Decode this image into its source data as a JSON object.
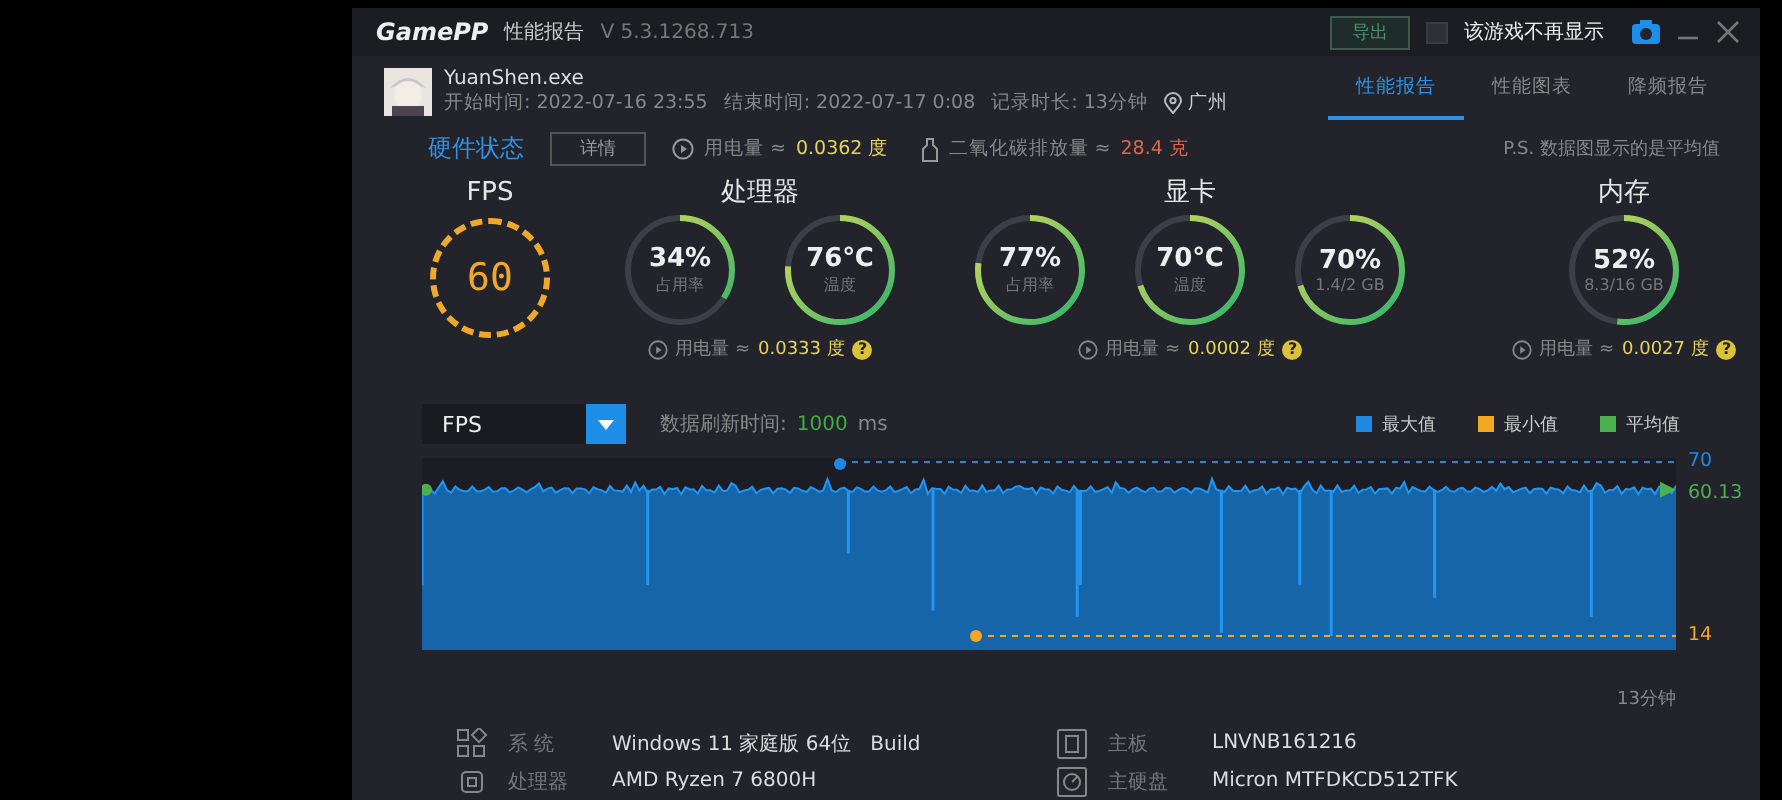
{
  "window": {
    "logo": "GamePP",
    "title": "性能报告",
    "version": "V 5.3.1268.713",
    "export_button": "导出",
    "hide_checkbox": {
      "label": "该游戏不再显示",
      "checked": false
    }
  },
  "session": {
    "exe": "YuanShen.exe",
    "start": "开始时间: 2022-07-16 23:55",
    "end": "结束时间: 2022-07-17 0:08",
    "duration": "记录时长: 13分钟",
    "location": "广州"
  },
  "tabs": [
    {
      "label": "性能报告",
      "selected": true
    },
    {
      "label": "性能图表",
      "selected": false
    },
    {
      "label": "降频报告",
      "selected": false
    }
  ],
  "hardware": {
    "title": "硬件状态",
    "details_button": "详情",
    "power_label": "用电量 ≈",
    "power_value": "0.0362 度",
    "co2_label": "二氧化碳排放量 ≈",
    "co2_value": "28.4 克",
    "note": "P.S. 数据图显示的是平均值"
  },
  "fps": {
    "title": "FPS",
    "value": "60"
  },
  "groups": [
    {
      "title": "处理器",
      "power_label": "用电量 ≈",
      "power_value": "0.0333 度",
      "help_mark": "?",
      "gauges": [
        {
          "value": "34%",
          "label": "占用率",
          "level": 0.34
        },
        {
          "value": "76℃",
          "label": "温度",
          "level": 0.76
        }
      ]
    },
    {
      "title": "显卡",
      "power_label": "用电量 ≈",
      "power_value": "0.0002 度",
      "help_mark": "?",
      "gauges": [
        {
          "value": "77%",
          "label": "占用率",
          "level": 0.77
        },
        {
          "value": "70℃",
          "label": "温度",
          "level": 0.7
        },
        {
          "value": "70%",
          "label": "1.4/2 GB",
          "level": 0.7
        }
      ]
    },
    {
      "title": "内存",
      "power_label": "用电量 ≈",
      "power_value": "0.0027 度",
      "help_mark": "?",
      "gauges": [
        {
          "value": "52%",
          "label": "8.3/16 GB",
          "level": 0.52
        }
      ]
    }
  ],
  "chart": {
    "metric": "FPS",
    "refresh_label": "数据刷新时间:",
    "refresh_value": "1000",
    "refresh_unit": "ms",
    "legend": [
      {
        "label": "最大值",
        "color": "#1e88e5"
      },
      {
        "label": "最小值",
        "color": "#f5a623"
      },
      {
        "label": "平均值",
        "color": "#4caf50"
      }
    ],
    "max_label": "70",
    "avg_label": "60.13",
    "min_label": "14",
    "duration_label": "13分钟"
  },
  "system_info": [
    {
      "kind": "os",
      "label": "系 统",
      "value": "Windows 11 家庭版 64位   Build"
    },
    {
      "kind": "board",
      "label": "主板",
      "value": "LNVNB161216"
    },
    {
      "kind": "cpu",
      "label": "处理器",
      "value": "AMD Ryzen 7 6800H"
    },
    {
      "kind": "disk",
      "label": "主硬盘",
      "value": "Micron MTFDKCD512TFK"
    }
  ]
}
